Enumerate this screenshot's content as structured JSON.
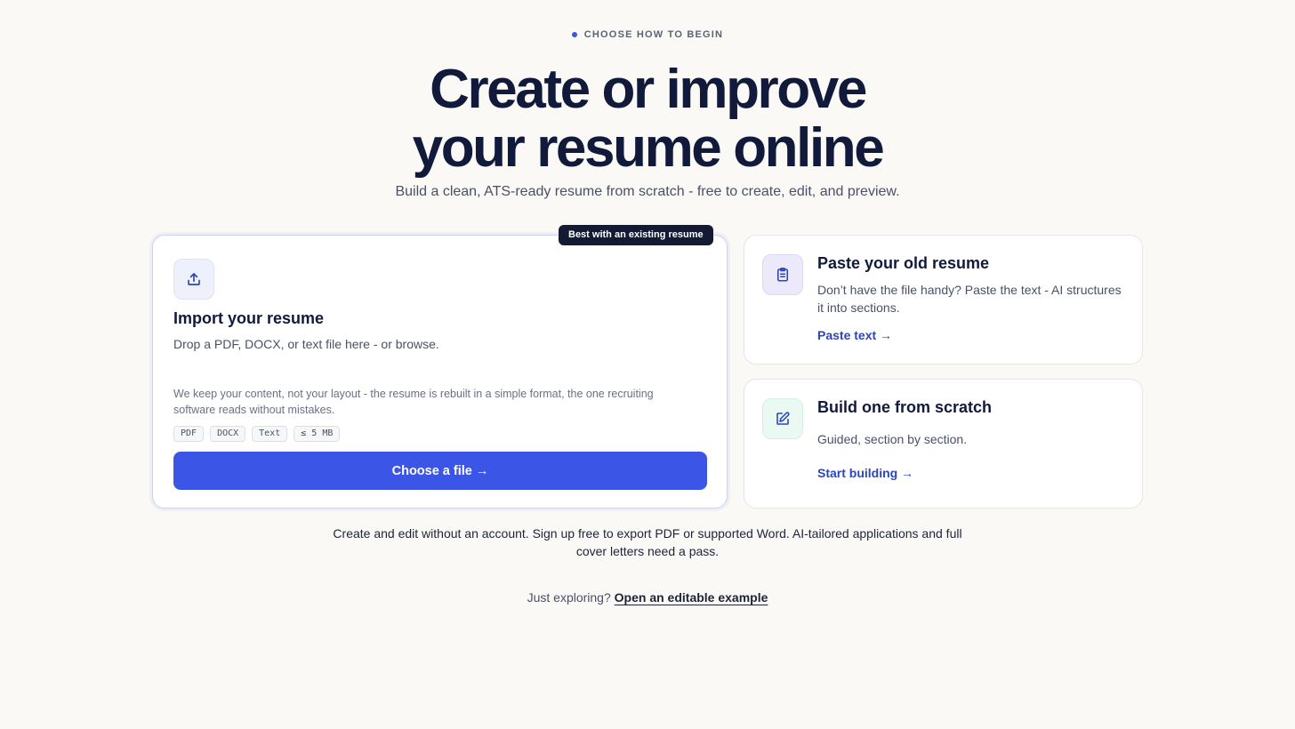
{
  "eyebrow": "CHOOSE HOW TO BEGIN",
  "hero": {
    "title_line1": "Create or improve",
    "title_line2": "your resume online",
    "subtitle": "Build a clean, ATS-ready resume from scratch - free to create, edit, and preview."
  },
  "import_card": {
    "badge": "Best with an existing resume",
    "icon": "upload-icon",
    "title": "Import your resume",
    "description": "Drop a PDF, DOCX, or text file here - or browse.",
    "note": "We keep your content, not your layout - the resume is rebuilt in a simple format, the one recruiting software reads without mistakes.",
    "chips": [
      "PDF",
      "DOCX",
      "Text",
      "≤ 5 MB"
    ],
    "button_label": "Choose a file →"
  },
  "paste_card": {
    "icon": "clipboard-icon",
    "title": "Paste your old resume",
    "description": "Don’t have the file handy? Paste the text - AI structures it into sections.",
    "link_label": "Paste text →"
  },
  "build_card": {
    "icon": "edit-icon",
    "title": "Build one from scratch",
    "description": "Guided, section by section.",
    "link_label": "Start building →"
  },
  "footer_note": "Create and edit without an account. Sign up free to export PDF or supported Word. AI-tailored applications and full cover letters need a pass.",
  "explore": {
    "prefix": "Just exploring?",
    "link_label": "Open an editable example"
  },
  "colors": {
    "accent": "#3b55e6",
    "link": "#2c45b8",
    "heading": "#111a3a",
    "background": "#faf9f6"
  }
}
